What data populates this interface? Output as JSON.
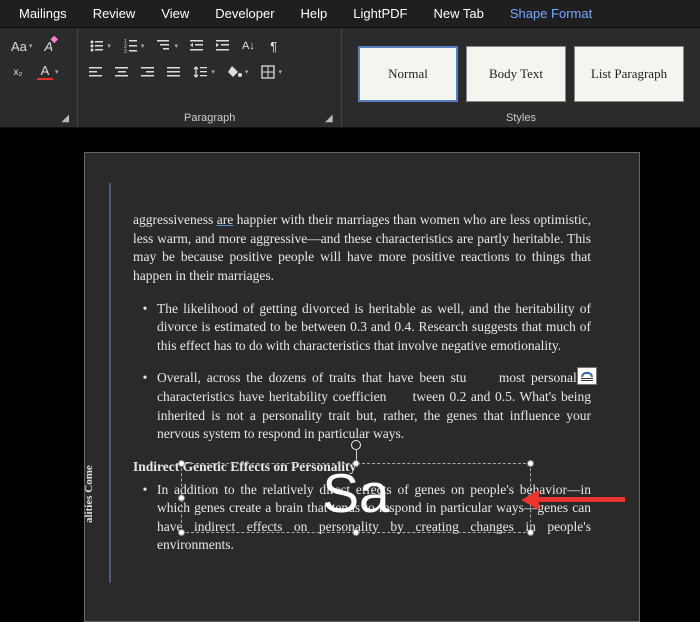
{
  "menu": {
    "items": [
      "Mailings",
      "Review",
      "View",
      "Developer",
      "Help",
      "LightPDF",
      "New Tab",
      "Shape Format"
    ],
    "highlight_index": 7
  },
  "ribbon": {
    "paragraph_label": "Paragraph",
    "styles_label": "Styles"
  },
  "styles": [
    {
      "label": "Normal",
      "selected": true
    },
    {
      "label": "Body Text",
      "selected": false
    },
    {
      "label": "List Paragraph",
      "selected": false
    }
  ],
  "document": {
    "para1": "aggressiveness are happier with their marriages than women who are less optimistic, less warm, and more aggressive—and these characteristics are partly heritable. This may be because positive people will have more positive reactions to things that happen in their marriages.",
    "bullet1": "The likelihood of getting divorced is heritable as well, and the heritability of divorce is estimated to be between 0.3 and 0.4. Research suggests that much of this effect has to do with characteristics that involve negative emotionality.",
    "bullet2a": "Overall, across the dozens of traits that have been stu",
    "bullet2b": "most personality characteristics have heritability coefficien",
    "bullet2c": "tween 0.2 and 0.5. What's being inherited is not a personality trait but, rather, the genes that influence your nervous system to respond in particular ways.",
    "heading": "Indirect Genetic Effects on Personality",
    "bullet3": "In addition to the relatively direct effects of genes on people's behavior—in which genes create a brain that tends to respond in particular ways—genes can have indirect effects on personality by creating changes in people's environments.",
    "side_tab": "alities Come",
    "spell_word": "are",
    "textbox_content": "Sa"
  }
}
